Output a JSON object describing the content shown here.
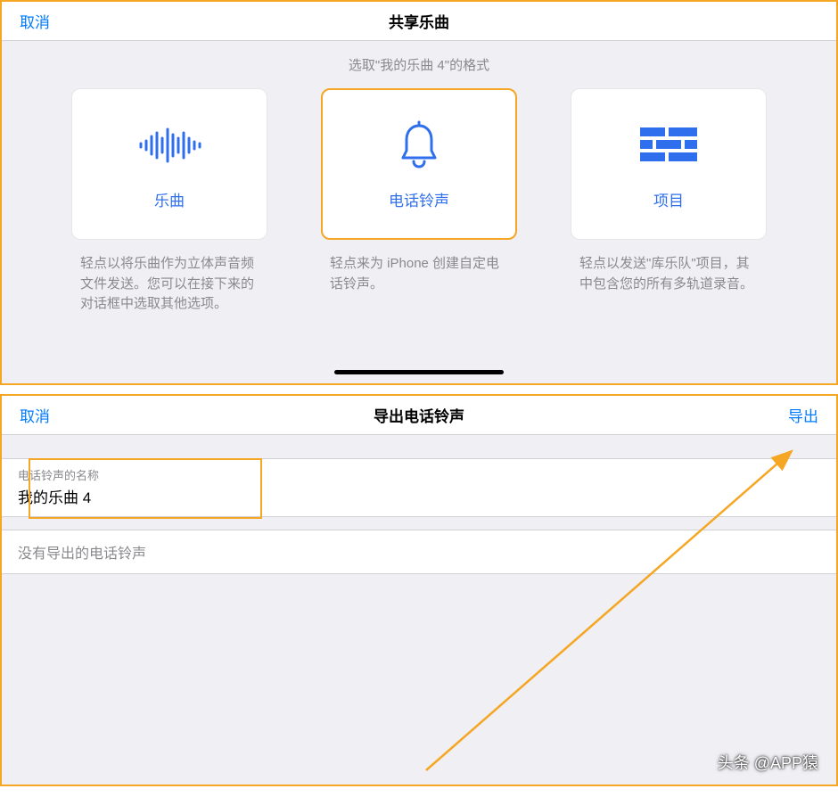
{
  "panel1": {
    "cancel": "取消",
    "title": "共享乐曲",
    "subtitle": "选取\"我的乐曲 4\"的格式",
    "cards": [
      {
        "label": "乐曲",
        "desc": "轻点以将乐曲作为立体声音频文件发送。您可以在接下来的对话框中选取其他选项。"
      },
      {
        "label": "电话铃声",
        "desc": "轻点来为 iPhone 创建自定电话铃声。"
      },
      {
        "label": "项目",
        "desc": "轻点以发送\"库乐队\"项目，其中包含您的所有多轨道录音。"
      }
    ]
  },
  "panel2": {
    "cancel": "取消",
    "title": "导出电话铃声",
    "export": "导出",
    "fieldLabel": "电话铃声的名称",
    "fieldValue": "我的乐曲 4",
    "emptyHint": "没有导出的电话铃声"
  },
  "watermark": "头条 @APP猿"
}
